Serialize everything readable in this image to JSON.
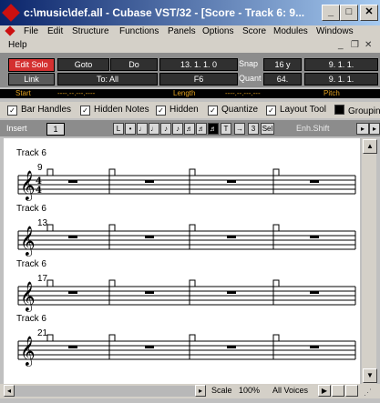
{
  "window": {
    "title": "c:\\music\\def.all - Cubase VST/32 - [Score - Track 6:  9...",
    "buttons": {
      "minimize": "_",
      "maximize": "□",
      "close": "✕"
    }
  },
  "menu": {
    "items": [
      "File",
      "Edit",
      "Structure",
      "Functions",
      "Panels",
      "Options",
      "Score",
      "Modules",
      "Windows",
      "Help"
    ],
    "mdi": {
      "minimize": "_",
      "restore": "❐",
      "close": "✕"
    }
  },
  "toolbar": {
    "edit_solo": "Edit Solo",
    "link": "Link",
    "goto_value": "Goto",
    "do_value": "Do",
    "position": "13. 1. 1.     0",
    "to_value": "To: All",
    "f6": "F6",
    "snap_label": "Snap",
    "snap_value": "16 y",
    "quant_label": "Quant",
    "quant_value": "64.",
    "right_pos1": "9. 1. 1.",
    "right_pos2": "9. 1. 1."
  },
  "infostrip": {
    "start": "Start",
    "start_val": "----.--.---.----",
    "length": "Length",
    "length_val": "----.--.---.---",
    "pitch": "Pitch"
  },
  "checkboxes": [
    {
      "label": "Bar Handles",
      "checked": true
    },
    {
      "label": "Hidden Notes",
      "checked": true
    },
    {
      "label": "Hidden",
      "checked": true
    },
    {
      "label": "Quantize",
      "checked": true
    },
    {
      "label": "Layout Tool",
      "checked": true
    },
    {
      "label": "Grouping",
      "checked": false
    }
  ],
  "insertbar": {
    "insert_label": "Insert",
    "insert_value": "1",
    "tools": [
      "L",
      "•",
      "♩",
      "♩",
      "♪",
      "♪",
      "♬",
      "♬",
      "♬",
      "T",
      "→",
      "3"
    ],
    "sel_label": "Sel",
    "enh_label": "Enh.Shift"
  },
  "score": {
    "staves": [
      {
        "track": "Track 6",
        "measure": "9"
      },
      {
        "track": "Track 6",
        "measure": "13"
      },
      {
        "track": "Track 6",
        "measure": "17"
      },
      {
        "track": "Track 6",
        "measure": "21"
      }
    ]
  },
  "statusbar": {
    "scale_label": "Scale",
    "scale_value": "100%",
    "voices": "All Voices"
  },
  "colors": {
    "title_start": "#0a246a",
    "title_end": "#a6caf0",
    "edit_solo": "#d43030",
    "info_text": "#e0a020"
  }
}
